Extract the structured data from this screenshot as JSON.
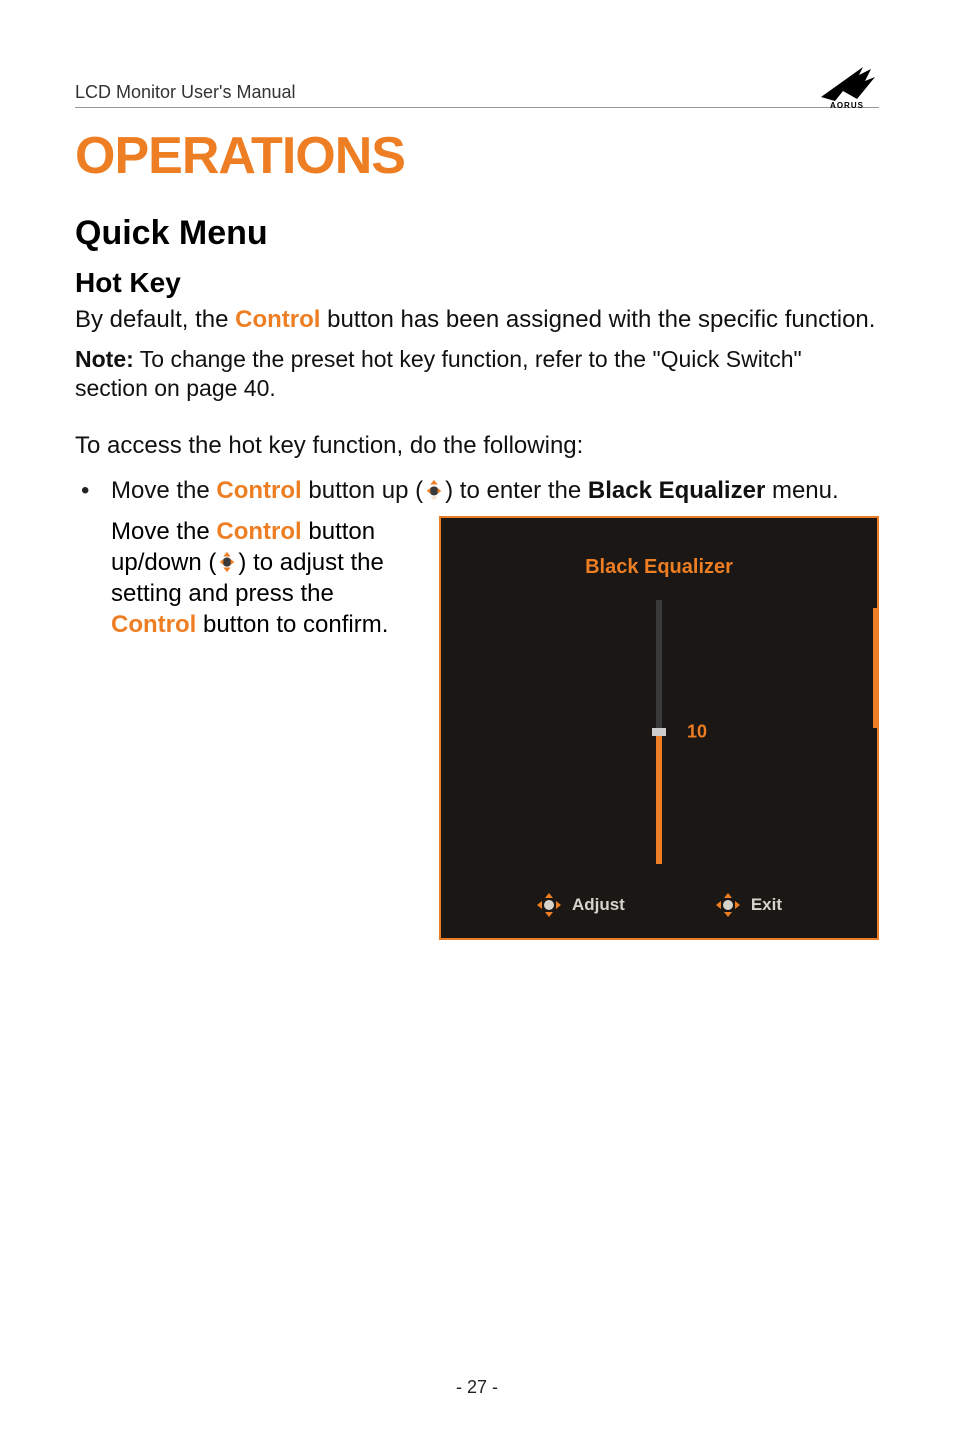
{
  "header": {
    "title": "LCD Monitor User's Manual"
  },
  "logo": {
    "name": "aorus-logo"
  },
  "h1": "OPERATIONS",
  "h2": "Quick Menu",
  "h3": "Hot Key",
  "intro": {
    "pre": "By default, the ",
    "control": "Control",
    "post": " button has been assigned with the specific function."
  },
  "note": {
    "label": "Note:",
    "text": " To change the preset hot key function, refer to the \"Quick Switch\" section on page 40."
  },
  "access": "To access the hot key function, do the following:",
  "bullet1": {
    "t1": "Move the ",
    "control": "Control",
    "t2": " button up (",
    "t3": ") to enter the ",
    "bold": "Black Equalizer",
    "t4": " menu."
  },
  "col_text": {
    "t1": "Move the ",
    "control1": "Control",
    "t2": " button up/down (",
    "t3": ") to adjust the setting and press the ",
    "control2": "Control",
    "t4": " button to confirm."
  },
  "osd": {
    "title": "Black Equalizer",
    "value": "10",
    "max": 20,
    "adjust": "Adjust",
    "exit": "Exit"
  },
  "page_number": "- 27 -",
  "icons": {
    "joystick": "joystick-icon",
    "joystick_up": "joystick-up-icon",
    "joystick_updown": "joystick-updown-icon"
  }
}
